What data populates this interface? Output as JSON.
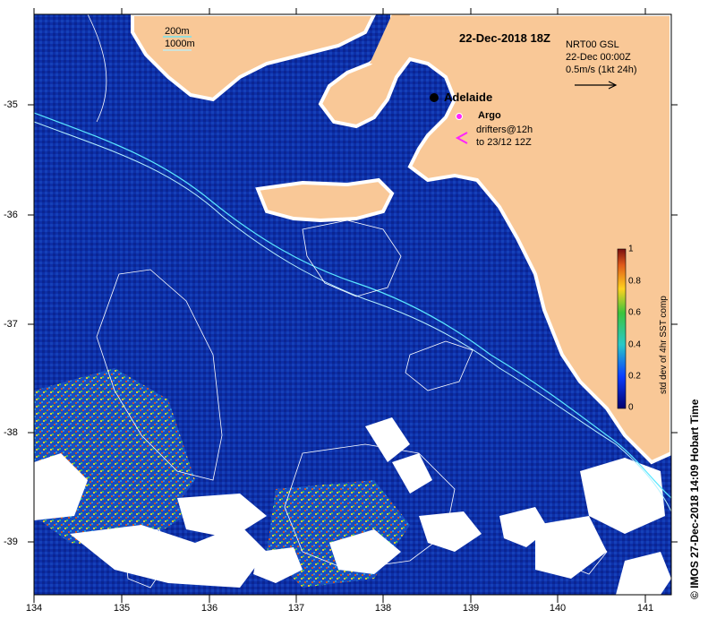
{
  "map": {
    "title": "22-Dec-2018 18Z",
    "product": "NRT00 GSL",
    "valid_time": "22-Dec 00:00Z",
    "velocity_scale": "0.5m/s (1kt 24h)",
    "city": "Adelaide",
    "argo_label": "Argo",
    "drifter_line1": "drifters@12h",
    "drifter_line2": "to 23/12 12Z",
    "isobath_200": "200m",
    "isobath_1000": "1000m",
    "footer": "© IMOS 27-Dec-2018 14:09 Hobart Time",
    "colorbar_title": "std dev of 4hr SST comp",
    "colorbar_ticks": [
      "1",
      "0.8",
      "0.6",
      "0.4",
      "0.2",
      "0"
    ],
    "lon_ticks": [
      "134",
      "135",
      "136",
      "137",
      "138",
      "139",
      "140",
      "141"
    ],
    "lat_ticks": [
      "-35",
      "-36",
      "-37",
      "-38",
      "-39"
    ],
    "colors": {
      "land": "#f9c897",
      "ocean": "#0a2a9e",
      "cloud": "#ffffff",
      "isobath_200": "#5ce8ff",
      "isobath_1000": "#b6f2ff",
      "argo": "#ff22ff"
    }
  }
}
